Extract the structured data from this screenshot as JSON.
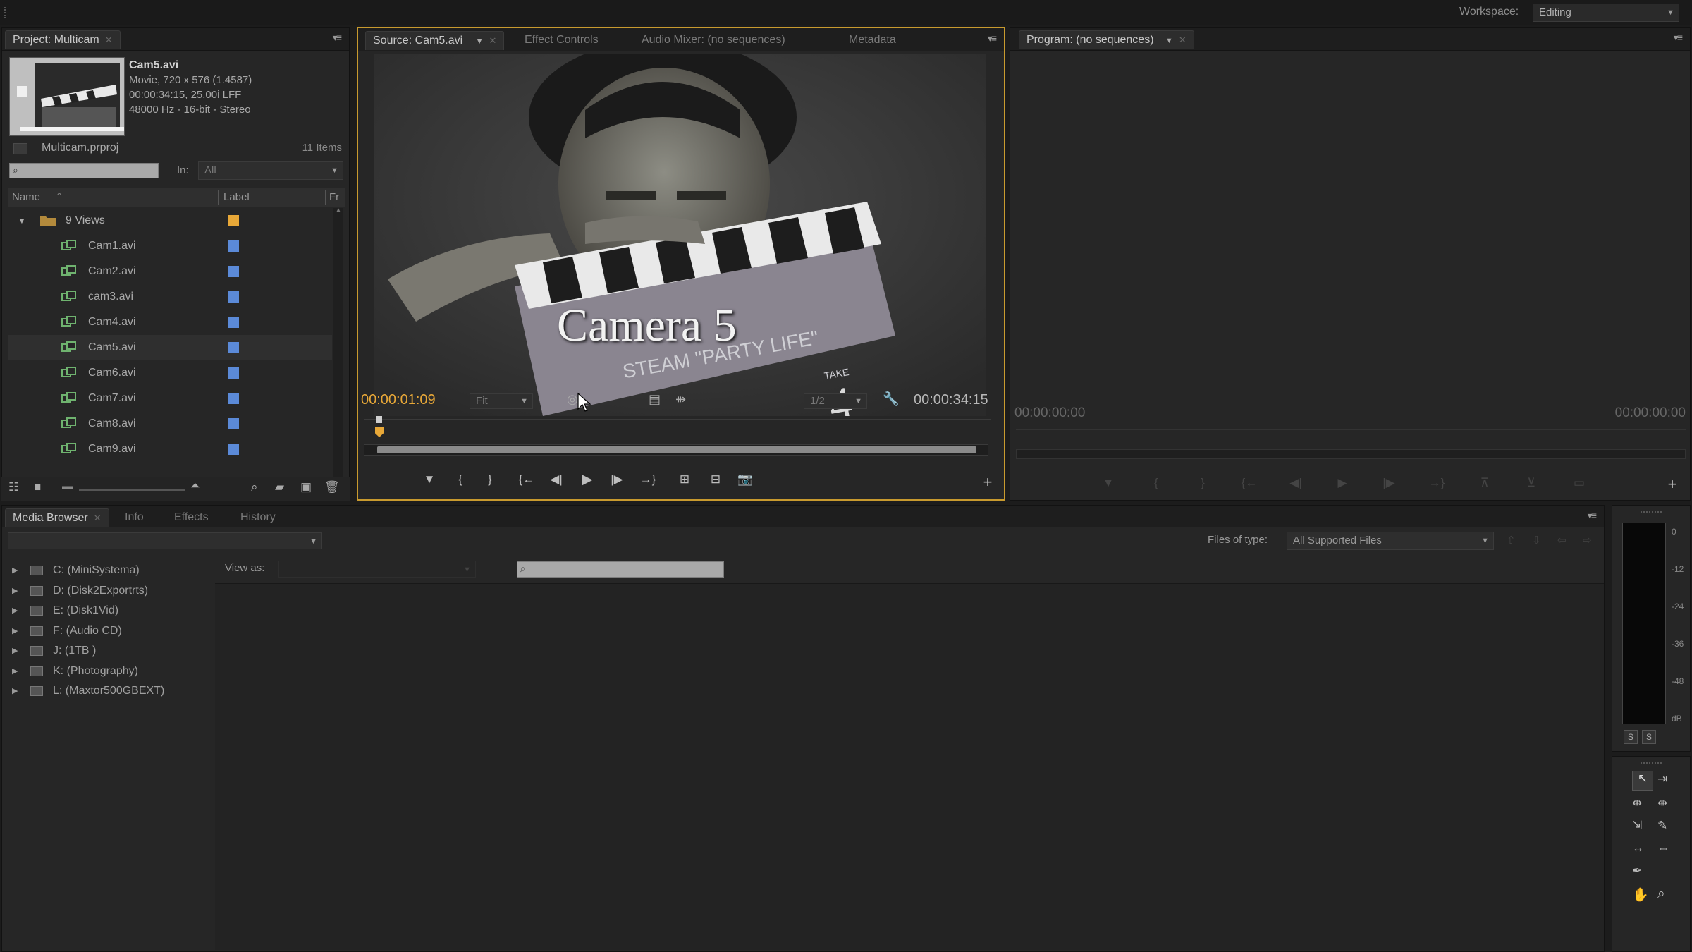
{
  "workspace": {
    "label": "Workspace:",
    "value": "Editing"
  },
  "project": {
    "tab": "Project: Multicam",
    "clip_name": "Cam5.avi",
    "clip_info": [
      "Movie, 720 x 576 (1.4587)",
      "00:00:34:15, 25.00i LFF",
      "48000 Hz - 16-bit - Stereo"
    ],
    "project_file": "Multicam.prproj",
    "items_count": "11 Items",
    "in_label": "In:",
    "in_value": "All",
    "columns": {
      "name": "Name",
      "label": "Label",
      "frame": "Fr"
    },
    "folder": {
      "name": "9 Views",
      "color": "#e8a838"
    },
    "items": [
      {
        "name": "Cam1.avi"
      },
      {
        "name": "Cam2.avi"
      },
      {
        "name": "cam3.avi"
      },
      {
        "name": "Cam4.avi"
      },
      {
        "name": "Cam5.avi"
      },
      {
        "name": "Cam6.avi"
      },
      {
        "name": "Cam7.avi"
      },
      {
        "name": "Cam8.avi"
      },
      {
        "name": "Cam9.avi"
      }
    ],
    "item_label_color": "#5b8ad8"
  },
  "source": {
    "tabs": [
      "Source: Cam5.avi",
      "Effect Controls",
      "Audio Mixer: (no sequences)",
      "Metadata"
    ],
    "overlay_text": "Camera 5",
    "clapper_text": "STEAM \"PARTY LIFE\"",
    "clapper_take": "TAKE",
    "clapper_take_num": "4",
    "current_time": "00:00:01:09",
    "duration": "00:00:34:15",
    "zoom": "Fit",
    "resolution": "1/2",
    "accent": "#e8a838"
  },
  "program": {
    "tab": "Program: (no sequences)",
    "time_left": "00:00:00:00",
    "time_right": "00:00:00:00"
  },
  "bottom": {
    "tabs": [
      "Media Browser",
      "Info",
      "Effects",
      "History"
    ],
    "files_of_type_label": "Files of type:",
    "files_of_type_value": "All Supported Files",
    "view_as_label": "View as:",
    "drives": [
      "C: (MiniSystema)",
      "D: (Disk2Exportrts)",
      "E: (Disk1Vid)",
      "F: (Audio CD)",
      "J: (1TB )",
      "K: (Photography)",
      "L: (Maxtor500GBEXT)"
    ]
  },
  "meter": {
    "scale": [
      "0",
      "-12",
      "-24",
      "-36",
      "-48",
      "dB"
    ],
    "solo": [
      "S",
      "S"
    ]
  }
}
